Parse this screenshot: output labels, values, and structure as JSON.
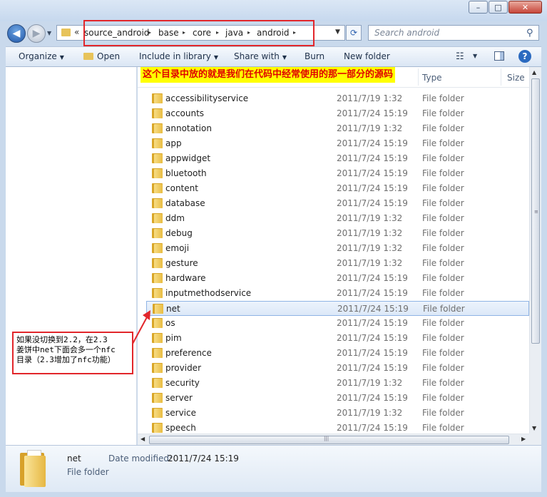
{
  "window": {
    "controls": {
      "minimize": "–",
      "maximize": "□",
      "close": "✕"
    }
  },
  "address": {
    "chevron": "«",
    "crumbs": [
      "source_android",
      "base",
      "core",
      "java",
      "android"
    ],
    "separator": "▸",
    "dropdown": "▼"
  },
  "search": {
    "placeholder": "Search android",
    "icon": "search-icon"
  },
  "toolbar": {
    "organize": "Organize",
    "open": "Open",
    "include_in_library": "Include in library",
    "share_with": "Share with",
    "burn": "Burn",
    "new_folder": "New folder",
    "dropdown_arrow": "▼",
    "help": "?"
  },
  "columns": {
    "type": "Type",
    "size": "Size"
  },
  "annotations": {
    "top": "这个目录中放的就是我们在代码中经常使用的那一部分的源码",
    "callout": [
      "如果没切换到2.2，在2.3",
      "姜饼中net下面会多一个nfc",
      "目录（2.3增加了nfc功能）"
    ]
  },
  "files": [
    {
      "name": "accessibilityservice",
      "date": "2011/7/19 1:32",
      "type": "File folder"
    },
    {
      "name": "accounts",
      "date": "2011/7/24 15:19",
      "type": "File folder"
    },
    {
      "name": "annotation",
      "date": "2011/7/19 1:32",
      "type": "File folder"
    },
    {
      "name": "app",
      "date": "2011/7/24 15:19",
      "type": "File folder"
    },
    {
      "name": "appwidget",
      "date": "2011/7/24 15:19",
      "type": "File folder"
    },
    {
      "name": "bluetooth",
      "date": "2011/7/24 15:19",
      "type": "File folder"
    },
    {
      "name": "content",
      "date": "2011/7/24 15:19",
      "type": "File folder"
    },
    {
      "name": "database",
      "date": "2011/7/24 15:19",
      "type": "File folder"
    },
    {
      "name": "ddm",
      "date": "2011/7/19 1:32",
      "type": "File folder"
    },
    {
      "name": "debug",
      "date": "2011/7/19 1:32",
      "type": "File folder"
    },
    {
      "name": "emoji",
      "date": "2011/7/19 1:32",
      "type": "File folder"
    },
    {
      "name": "gesture",
      "date": "2011/7/19 1:32",
      "type": "File folder"
    },
    {
      "name": "hardware",
      "date": "2011/7/24 15:19",
      "type": "File folder"
    },
    {
      "name": "inputmethodservice",
      "date": "2011/7/24 15:19",
      "type": "File folder"
    },
    {
      "name": "net",
      "date": "2011/7/24 15:19",
      "type": "File folder",
      "selected": true
    },
    {
      "name": "os",
      "date": "2011/7/24 15:19",
      "type": "File folder"
    },
    {
      "name": "pim",
      "date": "2011/7/24 15:19",
      "type": "File folder"
    },
    {
      "name": "preference",
      "date": "2011/7/24 15:19",
      "type": "File folder"
    },
    {
      "name": "provider",
      "date": "2011/7/24 15:19",
      "type": "File folder"
    },
    {
      "name": "security",
      "date": "2011/7/19 1:32",
      "type": "File folder"
    },
    {
      "name": "server",
      "date": "2011/7/24 15:19",
      "type": "File folder"
    },
    {
      "name": "service",
      "date": "2011/7/19 1:32",
      "type": "File folder"
    },
    {
      "name": "speech",
      "date": "2011/7/24 15:19",
      "type": "File folder"
    }
  ],
  "details": {
    "name": "net",
    "type": "File folder",
    "date_label": "Date modified:",
    "date_value": "2011/7/24 15:19"
  },
  "scrollbar": {
    "up": "▲",
    "down": "▼",
    "left": "◀",
    "right": "▶",
    "grip": "≡",
    "hgrip": "|||"
  }
}
